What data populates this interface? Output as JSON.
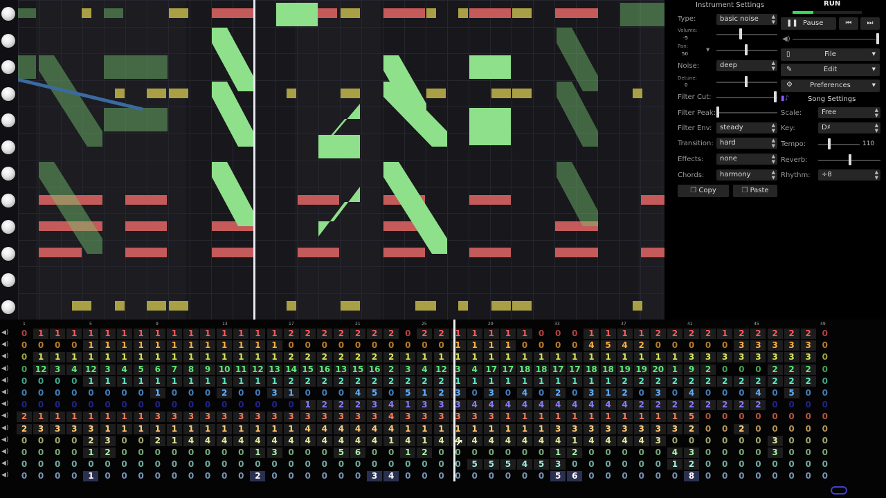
{
  "colors": {
    "note_red": "#c45a5a",
    "note_yellow": "#a9a045",
    "note_green": "#8fe08a",
    "panel_bg": "#000000",
    "select_bg": "#262626",
    "run_green": "#33dd55"
  },
  "transport": {
    "run_label": "RUN",
    "pause_label": "Pause",
    "pause_icon": "pause-icon",
    "prev_icon": "skip-back-icon",
    "next_icon": "skip-forward-icon"
  },
  "menus": {
    "file": "File",
    "edit": "Edit",
    "preferences": "Preferences",
    "song_settings": "Song Settings"
  },
  "instrument": {
    "title": "Instrument Settings",
    "type_label": "Type:",
    "type_value": "basic noise",
    "volume_label": "Volume:",
    "volume_value": "-5",
    "pan_label": "Pan:",
    "pan_value": "50",
    "noise_label": "Noise:",
    "noise_value": "deep",
    "detune_label": "Detune:",
    "detune_value": "0",
    "filter_cut_label": "Filter Cut:",
    "filter_peak_label": "Filter Peak:",
    "filter_env_label": "Filter Env:",
    "filter_env_value": "steady",
    "transition_label": "Transition:",
    "transition_value": "hard",
    "effects_label": "Effects:",
    "effects_value": "none",
    "chords_label": "Chords:",
    "chords_value": "harmony",
    "copy_label": "Copy",
    "paste_label": "Paste"
  },
  "song": {
    "scale_label": "Scale:",
    "scale_value": "Free",
    "key_label": "Key:",
    "key_value": "D♯",
    "tempo_label": "Tempo:",
    "tempo_value": "110",
    "reverb_label": "Reverb:",
    "rhythm_label": "Rhythm:",
    "rhythm_value": "÷8"
  },
  "ruler_ticks": [
    "1",
    "5",
    "9",
    "13",
    "17",
    "21",
    "25",
    "29",
    "33",
    "37",
    "41",
    "45",
    "49"
  ],
  "pattern": {
    "cell_colors": [
      "#ff5b5b",
      "#ffb040",
      "#d8e85a",
      "#5fe87a",
      "#5ce8c0",
      "#5fb0ff",
      "#6a5cff",
      "#ff7a5a",
      "#ffd07a",
      "#e8e8a0",
      "#a8f0a8",
      "#a0f0e0",
      "#a8d0ff",
      "#60c0ff"
    ],
    "rows": [
      "0111111111111111222222202211111000111122221222220",
      "0000111111111111000000000011110000454200000333330",
      "0111111111111111222222211111111111111111333333330",
      "0123412345678910111213141516131516234123417171818171718181919201920002220",
      "0000111111111111222222222211111111112222222222220",
      "0000000010002003100045051230304020312030400040500",
      "0000000000000000012223413334444444444222222220000",
      "2111111133333333333333433333311111111111500000000",
      "2333311111111111144444411111111133333333200200000",
      "0000230021444444444444141444444441444430000003000",
      "0000120000000013000560012000000012000004300003000",
      "0000000000000000000000000005554530000001200000000",
      "0000100000000020000003400000000056000000800000000"
    ]
  }
}
